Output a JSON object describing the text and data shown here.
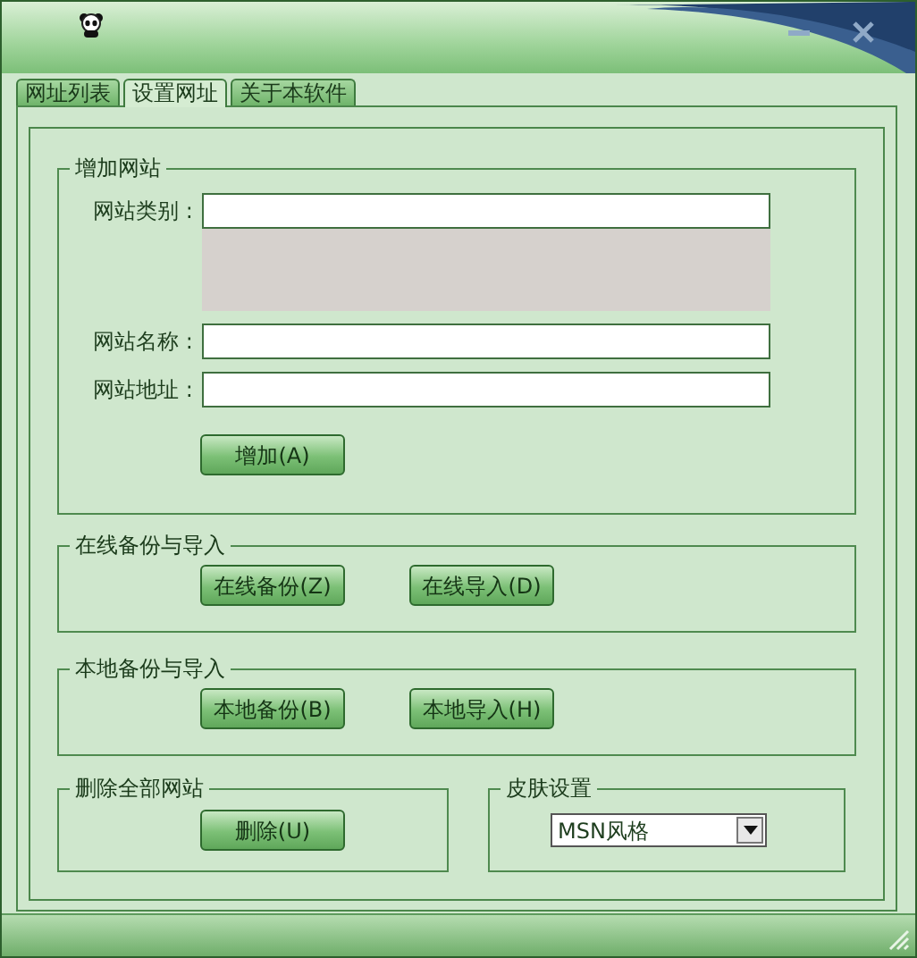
{
  "tabs": [
    {
      "label": "网址列表",
      "selected": false
    },
    {
      "label": "设置网址",
      "selected": true
    },
    {
      "label": "关于本软件",
      "selected": false
    }
  ],
  "add_site": {
    "title": "增加网站",
    "fields": [
      {
        "label": "网站类别 :",
        "kind": "category"
      },
      {
        "label": "网站名称 :",
        "kind": "text"
      },
      {
        "label": "网站地址 :",
        "kind": "text"
      }
    ],
    "button": "增加(A)"
  },
  "online_backup": {
    "title": "在线备份与导入",
    "buttons": [
      "在线备份(Z)",
      "在线导入(D)"
    ]
  },
  "local_backup": {
    "title": "本地备份与导入",
    "buttons": [
      "本地备份(B)",
      "本地导入(H)"
    ]
  },
  "delete_all": {
    "title": "删除全部网站",
    "button": "删除(U)"
  },
  "skin": {
    "title": "皮肤设置",
    "value": "MSN风格"
  }
}
